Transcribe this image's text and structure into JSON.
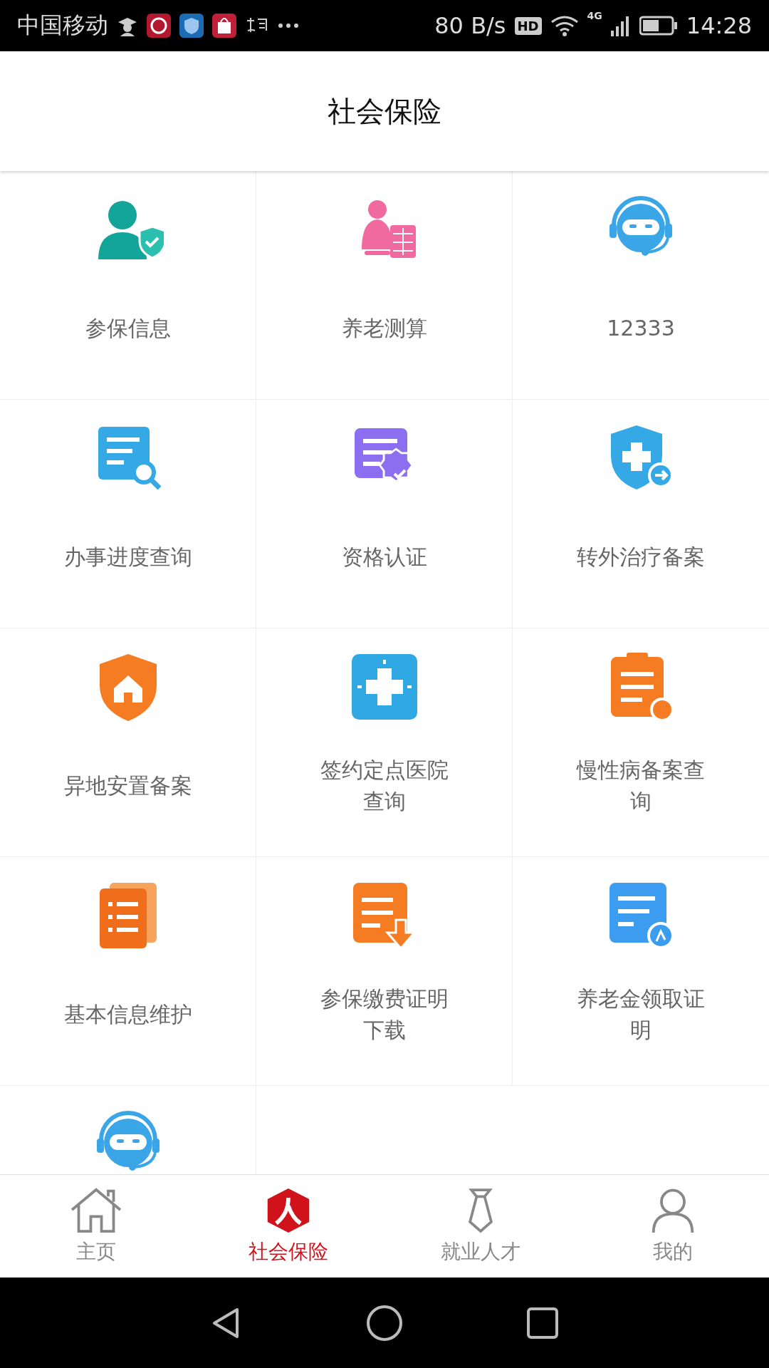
{
  "status_bar": {
    "carrier": "中国移动",
    "speed": "80 B/s",
    "hd": "HD",
    "network": "4G",
    "time": "14:28"
  },
  "header": {
    "title": "社会保险"
  },
  "grid": {
    "items": [
      {
        "kind": "labeled",
        "label": "参保信息"
      },
      {
        "kind": "labeled",
        "label": "养老测算"
      },
      {
        "kind": "labeled",
        "label": "12333"
      },
      {
        "kind": "labeled",
        "label": "办事进度查询"
      },
      {
        "kind": "labeled",
        "label": "资格认证"
      },
      {
        "kind": "labeled",
        "label": "转外治疗备案"
      },
      {
        "kind": "labeled",
        "label": "异地安置备案"
      },
      {
        "kind": "labeled",
        "label": "签约定点医院查询"
      },
      {
        "kind": "labeled",
        "label": "慢性病备案查询"
      },
      {
        "kind": "labeled",
        "label": "基本信息维护"
      },
      {
        "kind": "labeled",
        "label": "参保缴费证明下载"
      },
      {
        "kind": "labeled",
        "label": "养老金领取证明"
      },
      {
        "kind": "icon_only"
      }
    ]
  },
  "tabs": [
    {
      "label": "主页",
      "selected": false
    },
    {
      "label": "社会保险",
      "selected": true
    },
    {
      "label": "就业人才",
      "selected": false
    },
    {
      "label": "我的",
      "selected": false
    }
  ]
}
